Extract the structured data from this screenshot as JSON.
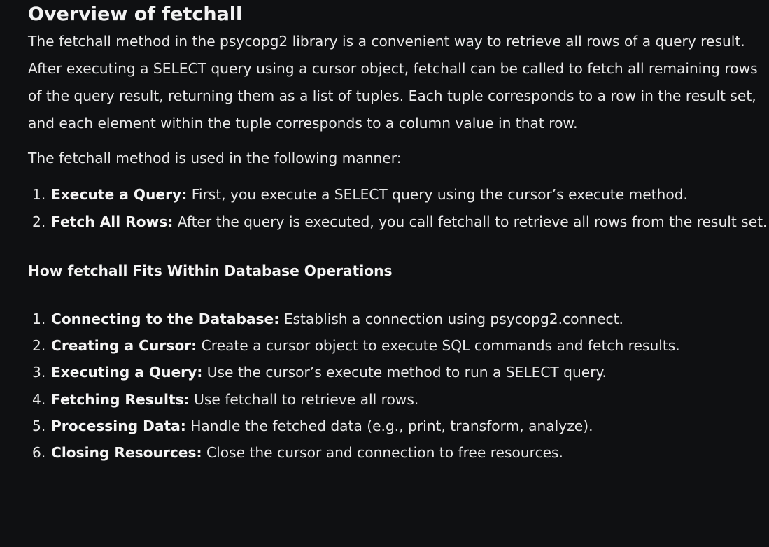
{
  "heading": "Overview of fetchall",
  "intro": "The fetchall method in the psycopg2 library is a convenient way to retrieve all rows of a query result. After executing a SELECT query using a cursor object, fetchall can be called to fetch all remaining rows of the query result, returning them as a list of tuples. Each tuple corresponds to a row in the result set, and each element within the tuple corresponds to a column value in that row.",
  "usage": "The fetchall method is used in the following manner:",
  "steps": [
    {
      "num": "1.",
      "label": "Execute a Query:",
      "text": " First, you execute a SELECT query using the cursor’s execute method."
    },
    {
      "num": "2.",
      "label": "Fetch All Rows:",
      "text": " After the query is executed, you call fetchall to retrieve all rows from the result set."
    }
  ],
  "subheading": "How fetchall Fits Within Database Operations",
  "operations": [
    {
      "num": "1.",
      "label": "Connecting to the Database:",
      "text": " Establish a connection using psycopg2.connect."
    },
    {
      "num": "2.",
      "label": "Creating a Cursor:",
      "text": " Create a cursor object to execute SQL commands and fetch results."
    },
    {
      "num": "3.",
      "label": "Executing a Query:",
      "text": " Use the cursor’s execute method to run a SELECT query."
    },
    {
      "num": "4.",
      "label": "Fetching Results:",
      "text": " Use fetchall to retrieve all rows."
    },
    {
      "num": "5.",
      "label": "Processing Data:",
      "text": " Handle the fetched data (e.g., print, transform, analyze)."
    },
    {
      "num": "6.",
      "label": "Closing Resources:",
      "text": " Close the cursor and connection to free resources."
    }
  ]
}
